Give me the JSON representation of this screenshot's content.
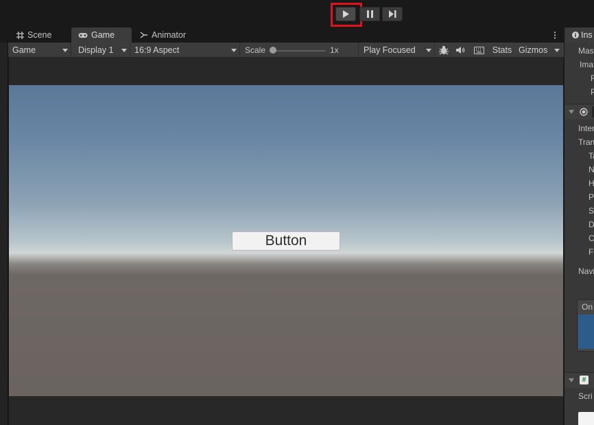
{
  "toolbar": {
    "play_icon": "play-icon",
    "pause_icon": "pause-icon",
    "step_icon": "step-icon",
    "highlight_color": "#e0141e"
  },
  "tabs": {
    "scene": "Scene",
    "game": "Game",
    "animator": "Animator"
  },
  "controls": {
    "view_mode": "Game",
    "display": "Display 1",
    "aspect": "16:9 Aspect",
    "scale_label": "Scale",
    "scale_value": "1x",
    "play_mode": "Play Focused",
    "stats": "Stats",
    "gizmos": "Gizmos"
  },
  "game_view": {
    "button_label": "Button"
  },
  "inspector": {
    "tab_label": "Ins",
    "lines_top": [
      "Mas",
      "Ima",
      "F",
      "P"
    ],
    "lines_mid": [
      "Inter",
      "Tran",
      "Ta",
      "N",
      "H",
      "P",
      "S",
      "D",
      "C",
      "Fa"
    ],
    "navigation": "Navi",
    "list_header": "On",
    "script_label": "Scri"
  }
}
